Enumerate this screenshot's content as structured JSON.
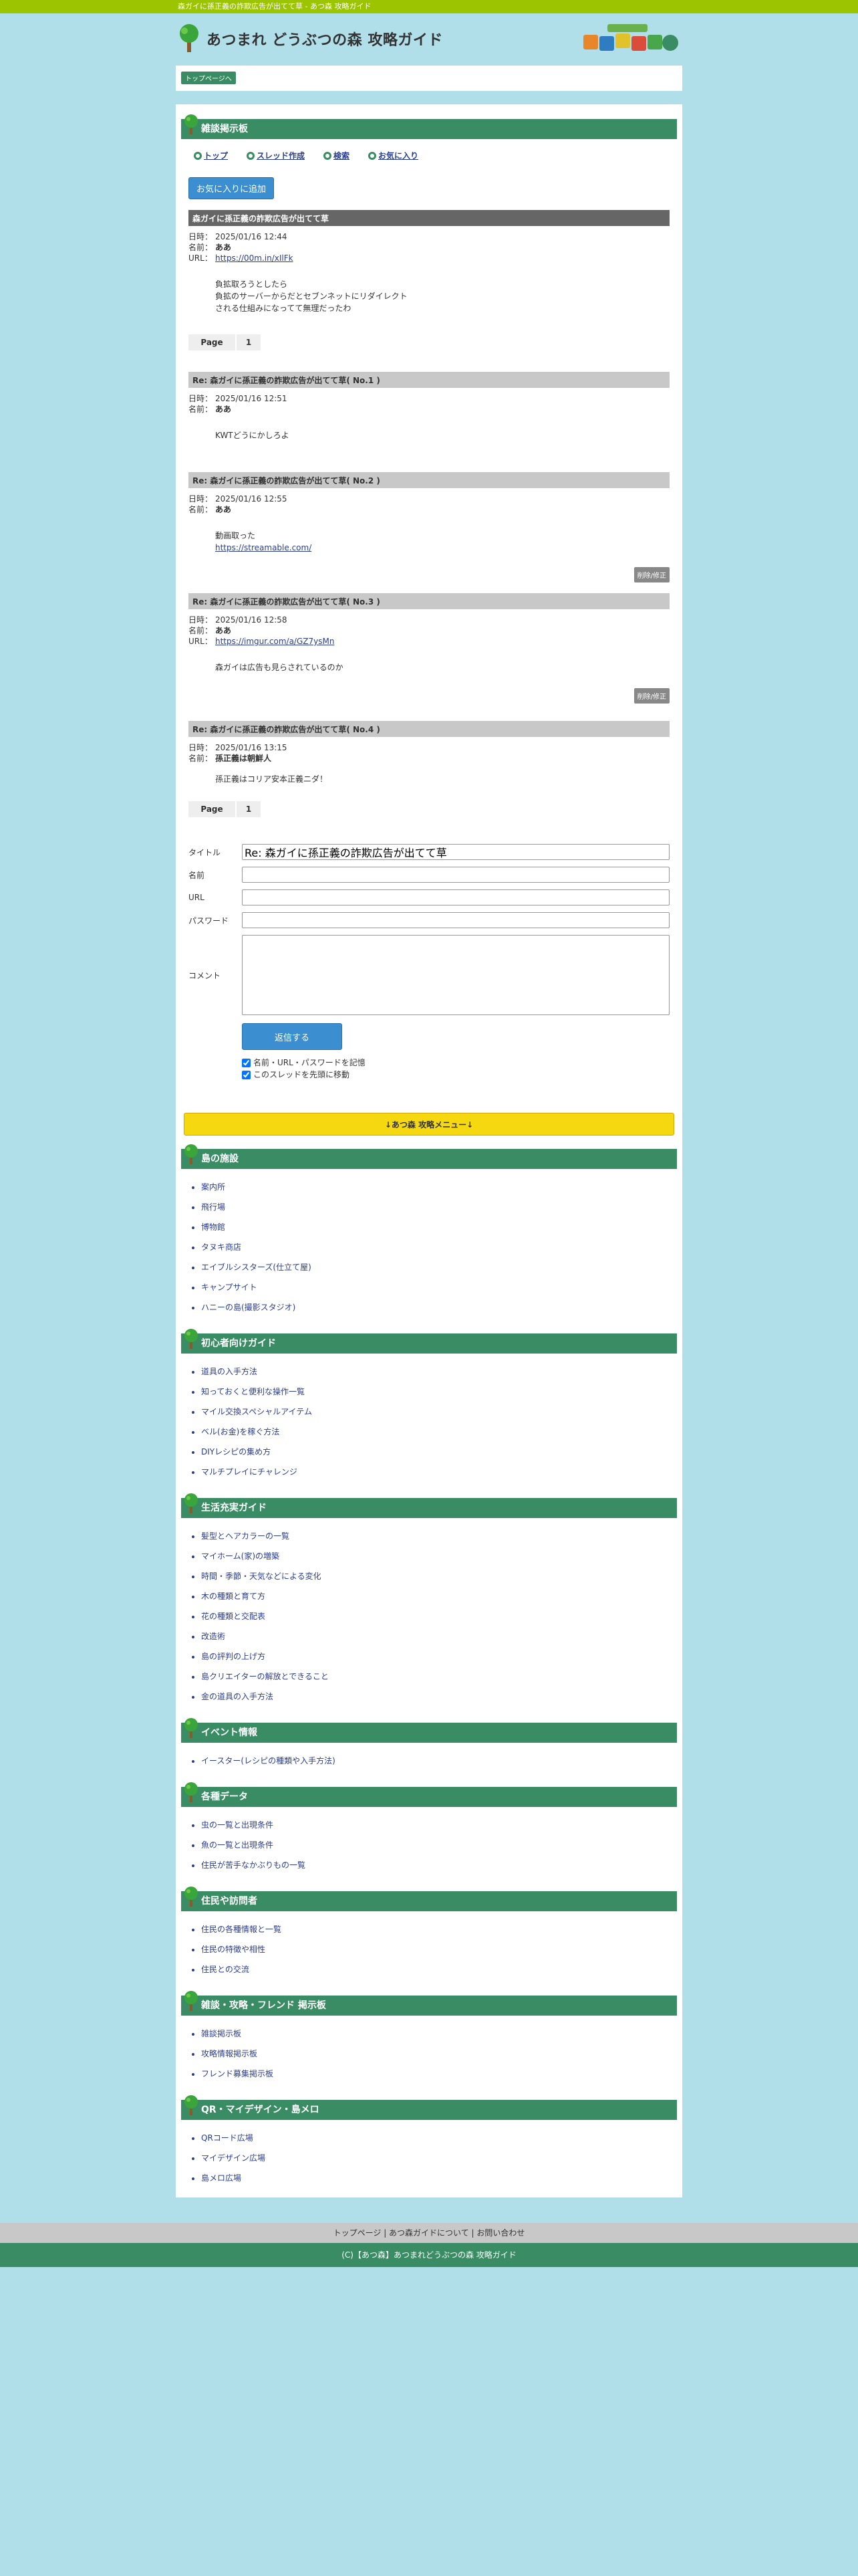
{
  "topbar": {
    "title": "森ガイに孫正義の詐欺広告が出てて草 - あつ森 攻略ガイド"
  },
  "header": {
    "site_title": "あつまれ どうぶつの森 攻略ガイド",
    "logo_text": "あつまれどうぶつの森"
  },
  "breadcrumb": {
    "top": "トップページへ"
  },
  "bbs": {
    "section_title": "雑談掲示板",
    "nav": [
      "トップ",
      "スレッド作成",
      "検索",
      "お気に入り"
    ],
    "fav_button": "お気に入りに追加",
    "main_post": {
      "title": "森ガイに孫正義の詐欺広告が出てて草",
      "date_label": "日時：",
      "date": "2025/01/16 12:44",
      "name_label": "名前：",
      "name": "ああ",
      "url_label": "URL：",
      "url": "https://00m.in/xIlFk",
      "body": [
        "負拡取ろうとしたら",
        "負拡のサーバーからだとセブンネットにリダイレクト",
        "される仕組みになってて無理だったわ"
      ]
    },
    "pager": {
      "label": "Page",
      "page": "1"
    },
    "replies": [
      {
        "title": "Re: 森ガイに孫正義の詐欺広告が出てて草( No.1 )",
        "date": "2025/01/16 12:51",
        "name": "ああ",
        "url": "",
        "body": [
          "KWTどうにかしろよ"
        ],
        "link": "",
        "edit": ""
      },
      {
        "title": "Re: 森ガイに孫正義の詐欺広告が出てて草( No.2 )",
        "date": "2025/01/16 12:55",
        "name": "ああ",
        "url": "",
        "body": [
          "動画取った"
        ],
        "link": "https://streamable.com/",
        "edit": "削除/修正"
      },
      {
        "title": "Re: 森ガイに孫正義の詐欺広告が出てて草( No.3 )",
        "date": "2025/01/16 12:58",
        "name": "ああ",
        "url": "https://imgur.com/a/GZ7ysMn",
        "body": [
          "森ガイは広告も見らされているのか"
        ],
        "link": "",
        "edit": "削除/修正"
      },
      {
        "title": "Re: 森ガイに孫正義の詐欺広告が出てて草( No.4 )",
        "date": "2025/01/16 13:15",
        "name": "孫正義は朝鮮人",
        "url": "",
        "body": [
          "孫正義はコリア安本正義ニダ！"
        ],
        "link": "",
        "edit": ""
      }
    ],
    "form": {
      "title_label": "タイトル",
      "title_value": "Re: 森ガイに孫正義の詐欺広告が出てて草",
      "name_label": "名前",
      "url_label": "URL",
      "password_label": "パスワード",
      "comment_label": "コメント",
      "submit": "返信する",
      "check_remember": "名前・URL・パスワードを記憶",
      "check_top": "このスレッドを先頭に移動"
    }
  },
  "menu": {
    "banner": "↓あつ森 攻略メニュー↓",
    "sections": [
      {
        "title": "島の施設",
        "items": [
          "案内所",
          "飛行場",
          "博物館",
          "タヌキ商店",
          "エイブルシスターズ(仕立て屋)",
          "キャンプサイト",
          "ハニーの島(撮影スタジオ)"
        ]
      },
      {
        "title": "初心者向けガイド",
        "items": [
          "道具の入手方法",
          "知っておくと便利な操作一覧",
          "マイル交換スペシャルアイテム",
          "ベル(お金)を稼ぐ方法",
          "DIYレシピの集め方",
          "マルチプレイにチャレンジ"
        ]
      },
      {
        "title": "生活充実ガイド",
        "items": [
          "髪型とヘアカラーの一覧",
          "マイホーム(家)の増築",
          "時間・季節・天気などによる変化",
          "木の種類と育て方",
          "花の種類と交配表",
          "改造術",
          "島の評判の上げ方",
          "島クリエイターの解放とできること",
          "金の道具の入手方法"
        ]
      },
      {
        "title": "イベント情報",
        "items": [
          "イースター(レシピの種類や入手方法)"
        ]
      },
      {
        "title": "各種データ",
        "items": [
          "虫の一覧と出現条件",
          "魚の一覧と出現条件",
          "住民が苦手なかぶりもの一覧"
        ]
      },
      {
        "title": "住民や訪問者",
        "items": [
          "住民の各種情報と一覧",
          "住民の特徴や相性",
          "住民との交流"
        ]
      },
      {
        "title": "雑談・攻略・フレンド 掲示板",
        "items": [
          "雑談掲示板",
          "攻略情報掲示板",
          "フレンド募集掲示板"
        ]
      },
      {
        "title": "QR・マイデザイン・島メロ",
        "items": [
          "QRコード広場",
          "マイデザイン広場",
          "島メロ広場"
        ]
      }
    ]
  },
  "footer": {
    "links": [
      "トップページ",
      "あつ森ガイドについて",
      "お問い合わせ"
    ],
    "copyright": "(C)【あつ森】あつまれどうぶつの森 攻略ガイド"
  },
  "colors": {
    "accent_green": "#3a8c64",
    "topbar_green": "#9cc400",
    "button_blue": "#3b8fd1",
    "banner_yellow": "#f5d80f",
    "page_bg": "#b0dfea"
  }
}
